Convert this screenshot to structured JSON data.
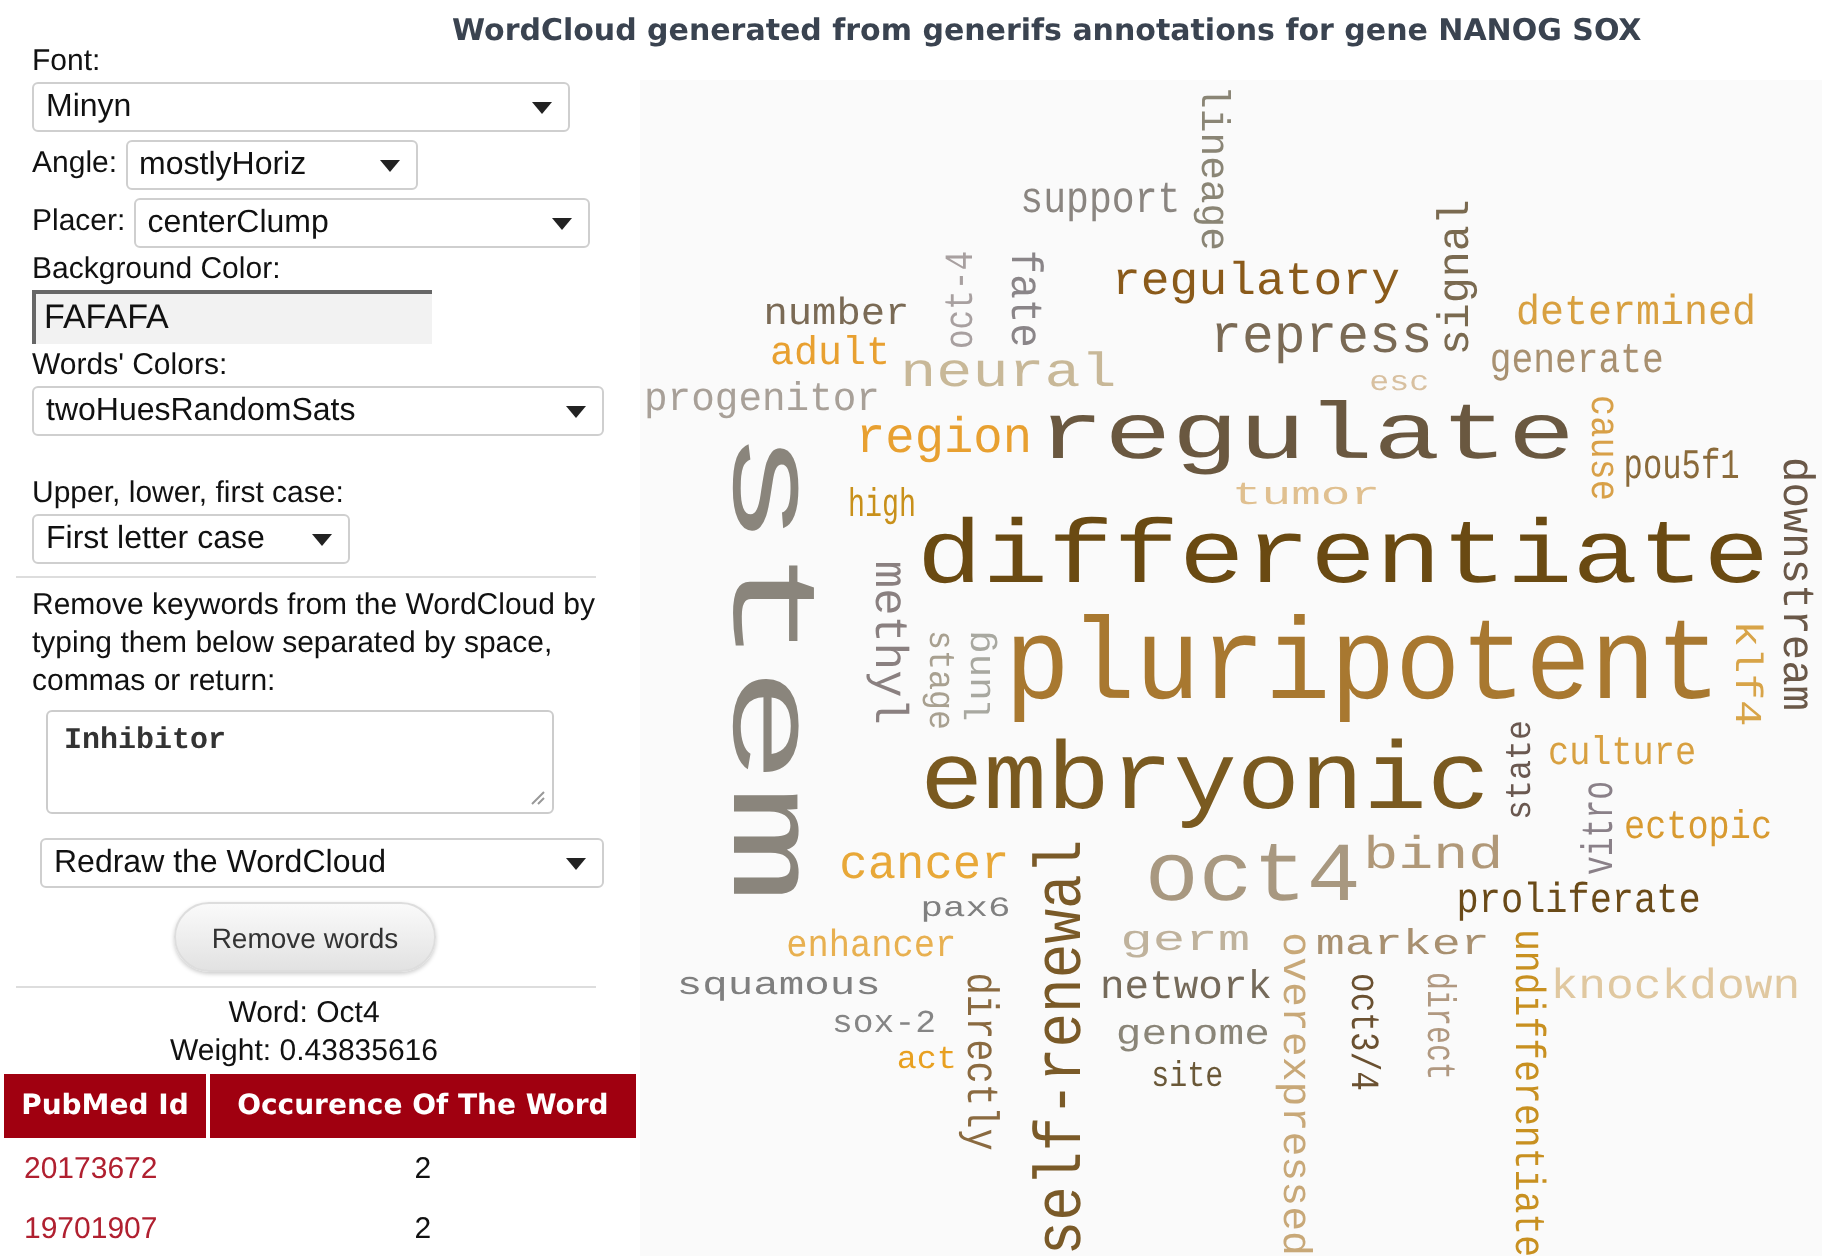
{
  "title": "WordCloud generated from generifs annotations for gene NANOG SOX",
  "font": {
    "label": "Font:",
    "value": "Minyn"
  },
  "angle": {
    "label": "Angle:",
    "value": "mostlyHoriz"
  },
  "placer": {
    "label": "Placer:",
    "value": "centerClump"
  },
  "background_color": {
    "label": "Background Color:",
    "value": "FAFAFA"
  },
  "words_colors": {
    "label": "Words' Colors:",
    "value": "twoHuesRandomSats"
  },
  "case": {
    "label": "Upper, lower, first case:",
    "value": "First letter case"
  },
  "remove": {
    "instructions": "Remove keywords from the WordCloud by typing them below separated by space, commas or return:",
    "value": "Inhibitor",
    "action": "Redraw the WordCloud",
    "button": "Remove words"
  },
  "word_info": {
    "word": "Word: Oct4",
    "weight": "Weight: 0.43835616"
  },
  "table": {
    "columns": [
      "PubMed Id",
      "Occurence Of The Word"
    ],
    "rows": [
      [
        "20173672",
        "2"
      ],
      [
        "19701907",
        "2"
      ]
    ]
  },
  "cloud": {
    "words": [
      {
        "text": "support",
        "kind": "horizontal",
        "color": "#8a8580"
      },
      {
        "text": "regulatory",
        "kind": "horizontal",
        "color": "#8a5a1a"
      },
      {
        "text": "number",
        "kind": "horizontal",
        "color": "#7a6a55"
      },
      {
        "text": "adult",
        "kind": "horizontal",
        "color": "#e8a030"
      },
      {
        "text": "neural",
        "kind": "horizontal",
        "color": "#c8b898"
      },
      {
        "text": "repress",
        "kind": "horizontal",
        "color": "#7a6a55"
      },
      {
        "text": "progenitor",
        "kind": "horizontal",
        "color": "#a8a098"
      },
      {
        "text": "determined",
        "kind": "horizontal",
        "color": "#d8a040"
      },
      {
        "text": "generate",
        "kind": "horizontal",
        "color": "#a89070"
      },
      {
        "text": "esc",
        "kind": "horizontal",
        "color": "#d8c0a0"
      },
      {
        "text": "region",
        "kind": "horizontal",
        "color": "#e8a030"
      },
      {
        "text": "regulate",
        "kind": "horizontal",
        "color": "#6a5840"
      },
      {
        "text": "tumor",
        "kind": "horizontal",
        "color": "#e0c090"
      },
      {
        "text": "pou5f1",
        "kind": "horizontal",
        "color": "#8a6a3a"
      },
      {
        "text": "high",
        "kind": "horizontal",
        "color": "#c8901a"
      },
      {
        "text": "differentiate",
        "kind": "horizontal",
        "color": "#6a4a12"
      },
      {
        "text": "pluripotent",
        "kind": "horizontal",
        "color": "#a87830"
      },
      {
        "text": "embryonic",
        "kind": "horizontal",
        "color": "#7a5a20"
      },
      {
        "text": "culture",
        "kind": "horizontal",
        "color": "#d8a040"
      },
      {
        "text": "ectopic",
        "kind": "horizontal",
        "color": "#d89a30"
      },
      {
        "text": "cancer",
        "kind": "horizontal",
        "color": "#e8a838"
      },
      {
        "text": "oct4",
        "kind": "horizontal",
        "color": "#a89880"
      },
      {
        "text": "bind",
        "kind": "horizontal",
        "color": "#b09878"
      },
      {
        "text": "pax6",
        "kind": "horizontal",
        "color": "#808080"
      },
      {
        "text": "proliferate",
        "kind": "horizontal",
        "color": "#6a4a18"
      },
      {
        "text": "enhancer",
        "kind": "horizontal",
        "color": "#e8b050"
      },
      {
        "text": "germ",
        "kind": "horizontal",
        "color": "#bfb29c"
      },
      {
        "text": "marker",
        "kind": "horizontal",
        "color": "#a89070"
      },
      {
        "text": "squamous",
        "kind": "horizontal",
        "color": "#7f7f7f"
      },
      {
        "text": "network",
        "kind": "horizontal",
        "color": "#756a5a"
      },
      {
        "text": "knockdown",
        "kind": "horizontal",
        "color": "#e0c8a0"
      },
      {
        "text": "sox-2",
        "kind": "horizontal",
        "color": "#858585"
      },
      {
        "text": "genome",
        "kind": "horizontal",
        "color": "#8a8578"
      },
      {
        "text": "act",
        "kind": "horizontal",
        "color": "#e8a020"
      },
      {
        "text": "site",
        "kind": "horizontal",
        "color": "#6a5838"
      },
      {
        "text": "lineage",
        "kind": "down",
        "color": "#8a8575"
      },
      {
        "text": "fate",
        "kind": "down",
        "color": "#8a8588"
      },
      {
        "text": "oct-4",
        "kind": "up",
        "color": "#a8a0a0"
      },
      {
        "text": "signal",
        "kind": "up",
        "color": "#7a6a50"
      },
      {
        "text": "cause",
        "kind": "down",
        "color": "#d8a048"
      },
      {
        "text": "downstream",
        "kind": "down",
        "color": "#6a5848"
      },
      {
        "text": "stem",
        "kind": "down",
        "color": "#8a857c"
      },
      {
        "text": "methyl",
        "kind": "down",
        "color": "#8a8080"
      },
      {
        "text": "stage",
        "kind": "down",
        "color": "#a8a090"
      },
      {
        "text": "lung",
        "kind": "up",
        "color": "#a8a8a0"
      },
      {
        "text": "klf4",
        "kind": "down",
        "color": "#d8a448"
      },
      {
        "text": "state",
        "kind": "up",
        "color": "#6a5850"
      },
      {
        "text": "vitro",
        "kind": "up",
        "color": "#8a8088"
      },
      {
        "text": "self-renewal",
        "kind": "up",
        "color": "#7a5a28"
      },
      {
        "text": "directly",
        "kind": "down",
        "color": "#8a6a40"
      },
      {
        "text": "overexpressed",
        "kind": "down",
        "color": "#c8a878"
      },
      {
        "text": "oct3/4",
        "kind": "down",
        "color": "#6a5030"
      },
      {
        "text": "direct",
        "kind": "down",
        "color": "#b09880"
      },
      {
        "text": "undifferentiate",
        "kind": "down",
        "color": "#c89020"
      }
    ]
  }
}
